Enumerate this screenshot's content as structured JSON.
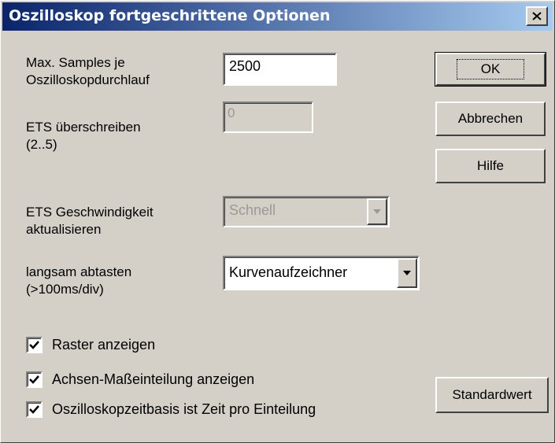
{
  "window": {
    "title": "Oszilloskop fortgeschrittene Optionen",
    "close_icon": "close-icon"
  },
  "fields": {
    "max_samples_label_line1": "Max. Samples je",
    "max_samples_label_line2": "Oszilloskopdurchlauf",
    "max_samples_value": "2500",
    "ets_override_label_line1": "ETS überschreiben",
    "ets_override_label_line2": "(2..5)",
    "ets_override_value": "0",
    "ets_speed_label_line1": "ETS Geschwindigkeit",
    "ets_speed_label_line2": "aktualisieren",
    "ets_speed_value": "Schnell",
    "slow_scan_label_line1": "langsam abtasten",
    "slow_scan_label_line2": "(>100ms/div)",
    "slow_scan_value": "Kurvenaufzeichner"
  },
  "buttons": {
    "ok": "OK",
    "cancel": "Abbrechen",
    "help": "Hilfe",
    "default": "Standardwert"
  },
  "checkboxes": [
    {
      "label": "Raster anzeigen",
      "checked": true
    },
    {
      "label": "Achsen-Maßeinteilung anzeigen",
      "checked": true
    },
    {
      "label": "Oszilloskopzeitbasis ist Zeit pro Einteilung",
      "checked": true
    }
  ],
  "colors": {
    "titlebar_start": "#0a246a",
    "titlebar_end": "#a6caf0",
    "face": "#d4d0c8"
  }
}
